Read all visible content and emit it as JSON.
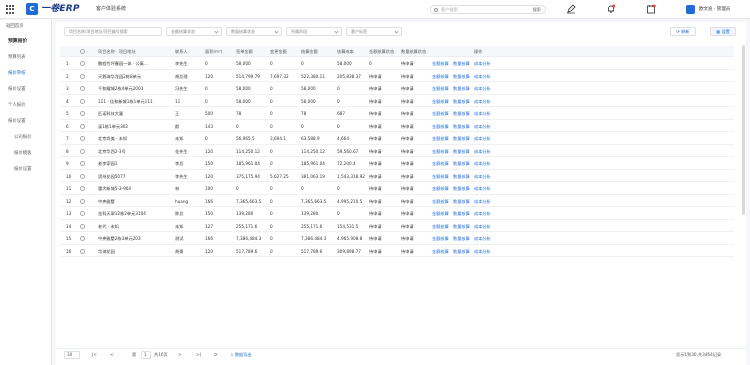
{
  "header": {
    "logo_letter": "C",
    "logo_text": "一卷ERP",
    "system_name": "客户体验系统",
    "search_placeholder": "客户搜索",
    "search_button": "搜索",
    "user_name": "欧文迪 · 管理员"
  },
  "sidebar": {
    "back": "返回首页",
    "items": [
      {
        "label": "预算报价",
        "type": "head"
      },
      {
        "label": "预算列表",
        "type": "item"
      },
      {
        "label": "报价审核",
        "type": "active"
      },
      {
        "label": "报价设置",
        "type": "item"
      },
      {
        "label": "个人报价",
        "type": "item"
      },
      {
        "label": "报价设置",
        "type": "item"
      },
      {
        "label": "公司报价",
        "type": "sub"
      },
      {
        "label": "报价模板",
        "type": "sub"
      },
      {
        "label": "报价设置",
        "type": "sub"
      }
    ]
  },
  "filters": [
    {
      "label": "项目名称/项目地址/项目编号搜索"
    },
    {
      "label": "金额核算状态"
    },
    {
      "label": "数量核算状态"
    },
    {
      "label": "所属阶段"
    },
    {
      "label": "客户标签"
    }
  ],
  "actions": {
    "refresh": "刷新",
    "settings": "设置"
  },
  "table": {
    "columns": [
      "",
      "项目名称 · 项目地址",
      "联系人",
      "面积(m²)",
      "签单金额",
      "变更金额",
      "结算金额",
      "核算成本",
      "金额核算状态",
      "数量核算状态",
      "操作"
    ],
    "ops": [
      "金额核算",
      "数量核算",
      "成本分析"
    ],
    "rows": [
      [
        "1",
        "鹏程竹坪春园一体 · 公寓...",
        "李先生",
        "0",
        "58,000",
        "0",
        "0",
        "58,000",
        "0",
        "待申请",
        "待申请"
      ],
      [
        "2",
        "天鹅海华龙园2栋8单元",
        "胡总理",
        "120",
        "514,799.79",
        "7,697.32",
        "522,380.11",
        "205,838.37",
        "待申请",
        "待申请"
      ],
      [
        "3",
        "千和耀城2栋4单元2003",
        "冯先生",
        "0",
        "58,000",
        "0",
        "58,000",
        "0",
        "待申请",
        "待申请"
      ],
      [
        "4",
        "111 · 佳和新城1栋1单元111",
        "11",
        "0",
        "58,000",
        "0",
        "58,000",
        "0",
        "待申请",
        "待申请"
      ],
      [
        "5",
        "匹诺科技大厦",
        "王",
        "500",
        "78",
        "0",
        "78",
        "687",
        "待申请",
        "待申请"
      ],
      [
        "6",
        "溪1栋1单元302",
        "颜",
        "143",
        "0",
        "0",
        "0",
        "0",
        "待申请",
        "待申请"
      ],
      [
        "7",
        "北京尚美 · 未知",
        "未知",
        "0",
        "56,965.5",
        "3,694.1",
        "63,588.9",
        "4,664",
        "待申请",
        "待申请"
      ],
      [
        "8",
        "北京华西2-3号",
        "金先生",
        "120",
        "114,250.12",
        "0",
        "114,250.12",
        "59,560.67",
        "待申请",
        "待申请"
      ],
      [
        "9",
        "老李家园1",
        "李总",
        "150",
        "185,961.04",
        "0",
        "185,961.04",
        "72,200.4",
        "待申请",
        "待申请"
      ],
      [
        "10",
        "滨州花园5077",
        "李先生",
        "120",
        "375,175.94",
        "5,627.25",
        "381,063.19",
        "1,543,318.92",
        "待申请",
        "待申请"
      ],
      [
        "11",
        "惠大新城5-3-904",
        "林",
        "100",
        "0",
        "0",
        "0",
        "0",
        "待申请",
        "待申请"
      ],
      [
        "12",
        "中央雅墅",
        "huang",
        "166",
        "7,365,663.5",
        "0",
        "7,365,663.5",
        "4,995,210.5",
        "待申请",
        "待申请"
      ],
      [
        "13",
        "金科天翠12栋2单元3104",
        "陈总",
        "150",
        "139,280",
        "0",
        "139,280",
        "0",
        "待申请",
        "待申请"
      ],
      [
        "14",
        "老代 · 未知",
        "未知",
        "127",
        "255,171.6",
        "0",
        "255,171.6",
        "154,531.5",
        "待申请",
        "待申请"
      ],
      [
        "15",
        "中央雅墅2栋3单元203",
        "测试",
        "166",
        "7,386,484.3",
        "0",
        "7,386,484.3",
        "4,965,908.8",
        "待申请",
        "待申请"
      ],
      [
        "16",
        "华海花园",
        "胡哥",
        "120",
        "517,789.6",
        "0",
        "517,789.6",
        "309,898.77",
        "待申请",
        "待申请"
      ]
    ]
  },
  "footer": {
    "page_size": "30",
    "page_label": "第",
    "page_num": "1",
    "page_total": "共16页",
    "export": "数据导出",
    "summary": "显示1到30,共3464记录"
  },
  "colors": {
    "accent": "#1f6bd8",
    "brand": "#1a3a8f"
  }
}
